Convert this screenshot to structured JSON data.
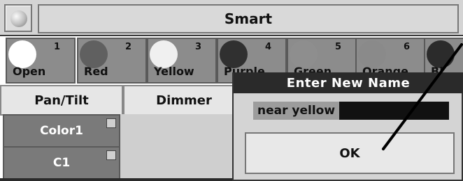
{
  "header": {
    "title": "Smart"
  },
  "palette": [
    {
      "number": "1",
      "name": "Open",
      "color": "#ffffff"
    },
    {
      "number": "2",
      "name": "Red",
      "color": "#606060"
    },
    {
      "number": "3",
      "name": "Yellow",
      "color": "#f0f0f0"
    },
    {
      "number": "4",
      "name": "Purple",
      "color": "#303030"
    },
    {
      "number": "5",
      "name": "Green",
      "color": "#8e8e8e"
    },
    {
      "number": "6",
      "name": "Orange",
      "color": "#8a8a8a"
    },
    {
      "number": "",
      "name": "Bl",
      "color": "#2b2b2b"
    }
  ],
  "tabs": [
    {
      "label": "Pan/Tilt"
    },
    {
      "label": "Dimmer"
    }
  ],
  "buttons": [
    {
      "label": "Color1"
    },
    {
      "label": "C1"
    }
  ],
  "dialog": {
    "title": "Enter New Name",
    "input_value": "near yellow",
    "ok_label": "OK"
  }
}
